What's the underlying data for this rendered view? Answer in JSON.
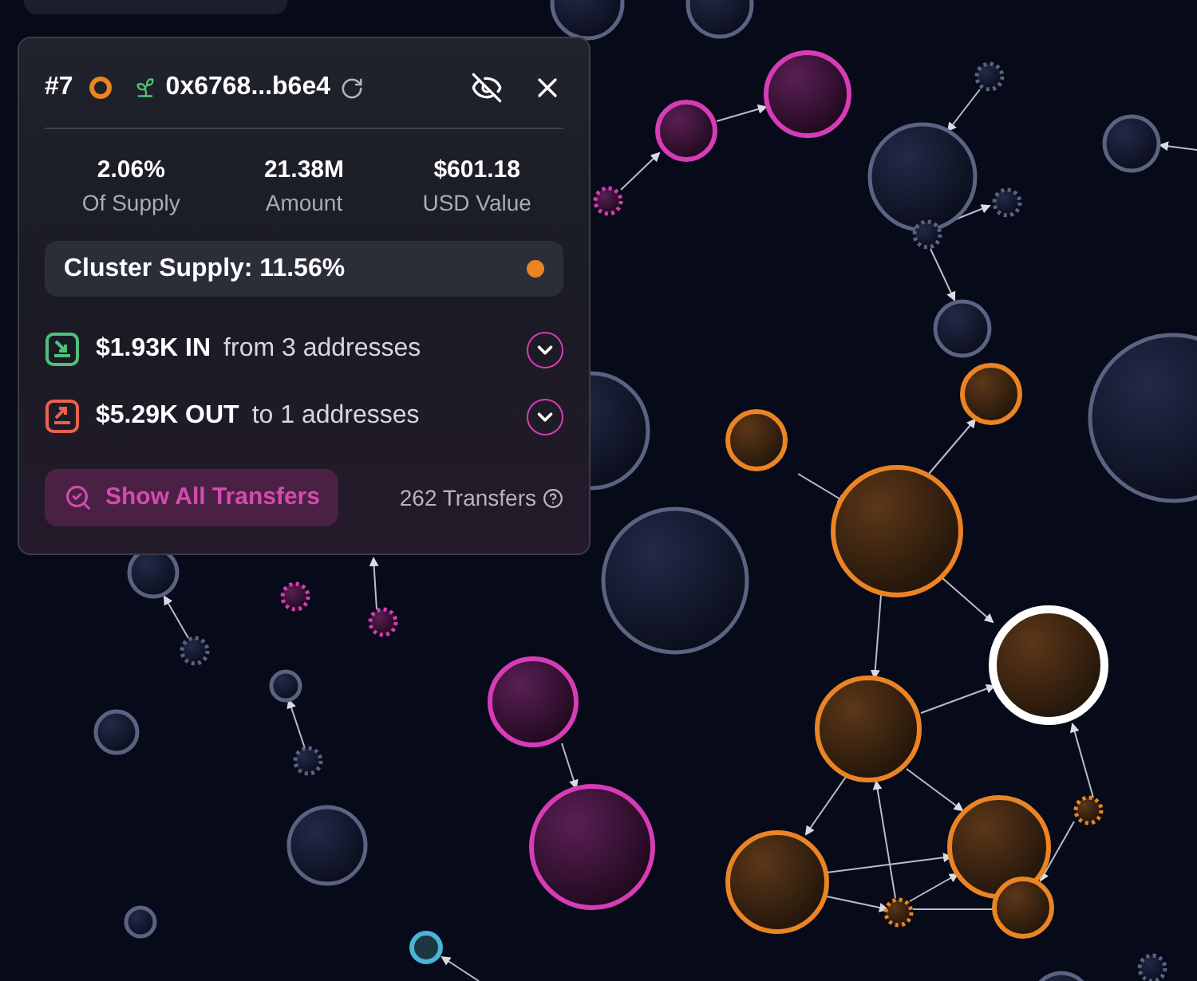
{
  "header": {
    "rank": "#7",
    "address": "0x6768...b6e4"
  },
  "stats": [
    {
      "value": "2.06%",
      "label": "Of Supply"
    },
    {
      "value": "21.38M",
      "label": "Amount"
    },
    {
      "value": "$601.18",
      "label": "USD Value"
    }
  ],
  "cluster_supply": "Cluster Supply: 11.56%",
  "flows": [
    {
      "kind": "in",
      "amount": "$1.93K IN",
      "detail": "from 3 addresses",
      "expanded": false
    },
    {
      "kind": "out",
      "amount": "$5.29K OUT",
      "detail": "to 1 addresses",
      "expanded": false
    }
  ],
  "footer": {
    "button": "Show All Transfers",
    "count": "262 Transfers"
  }
}
